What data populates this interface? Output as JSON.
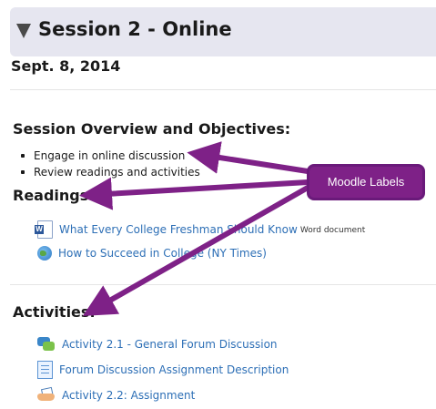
{
  "section": {
    "title": "Session 2 - Online",
    "date": "Sept. 8, 2014"
  },
  "overview": {
    "heading": "Session Overview and Objectives:",
    "bullets": [
      "Engage in online discussion",
      "Review readings and activities"
    ]
  },
  "readings": {
    "heading": "Readings:",
    "items": [
      {
        "label": "What Every College Freshman Should Know",
        "type": "Word document",
        "icon": "word-document-icon"
      },
      {
        "label": "How to Succeed in College (NY Times)",
        "type": "",
        "icon": "url-globe-icon"
      }
    ]
  },
  "activities": {
    "heading": "Activities:",
    "items": [
      {
        "label": "Activity 2.1 - General Forum Discussion",
        "icon": "forum-icon"
      },
      {
        "label": "Forum Discussion Assignment Description",
        "icon": "page-icon"
      },
      {
        "label": "Activity 2.2: Assignment",
        "icon": "assignment-icon"
      }
    ]
  },
  "annotation": {
    "label": "Moodle Labels",
    "color": "#7e2187"
  },
  "colors": {
    "link": "#2d6fb6",
    "header_bg": "#e6e6f0"
  }
}
